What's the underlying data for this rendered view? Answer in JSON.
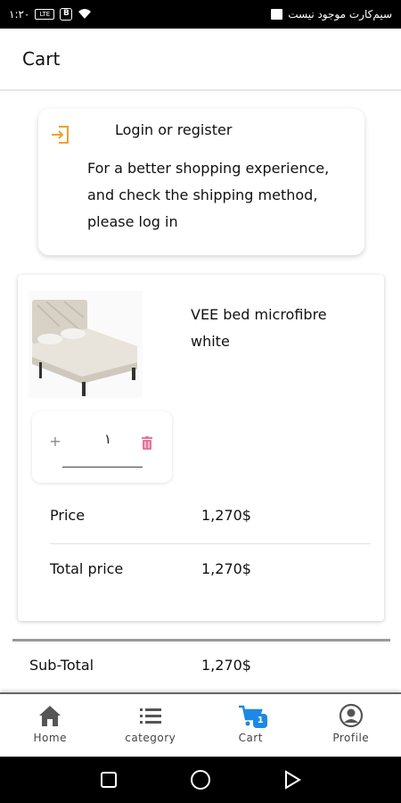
{
  "status_bar": {
    "time": "۱:۲۰",
    "carrier": "سیم‌کارت موجود نیست",
    "signal_label": "LTE",
    "box_label": "B"
  },
  "header": {
    "title": "Cart"
  },
  "login_card": {
    "title": "Login or register",
    "text": "For a better shopping experience, and check the shipping method, please log in",
    "accent_color": "#f0a030"
  },
  "cart_item": {
    "name": "VEE bed microfibre white",
    "quantity": "۱",
    "plus_label": "+",
    "price_label": "Price",
    "price_value": "1,270$",
    "total_label": "Total price",
    "total_value": "1,270$",
    "delete_color": "#e57399"
  },
  "summary": {
    "subtotal_label": "Sub-Total",
    "subtotal_value": "1,270$"
  },
  "bottom_nav": {
    "items": [
      {
        "label": "Home",
        "icon": "home-icon"
      },
      {
        "label": "category",
        "icon": "list-icon"
      },
      {
        "label": "Cart",
        "icon": "cart-icon",
        "badge": "1",
        "active_color": "#1e88e5"
      },
      {
        "label": "Profile",
        "icon": "profile-icon"
      }
    ]
  }
}
